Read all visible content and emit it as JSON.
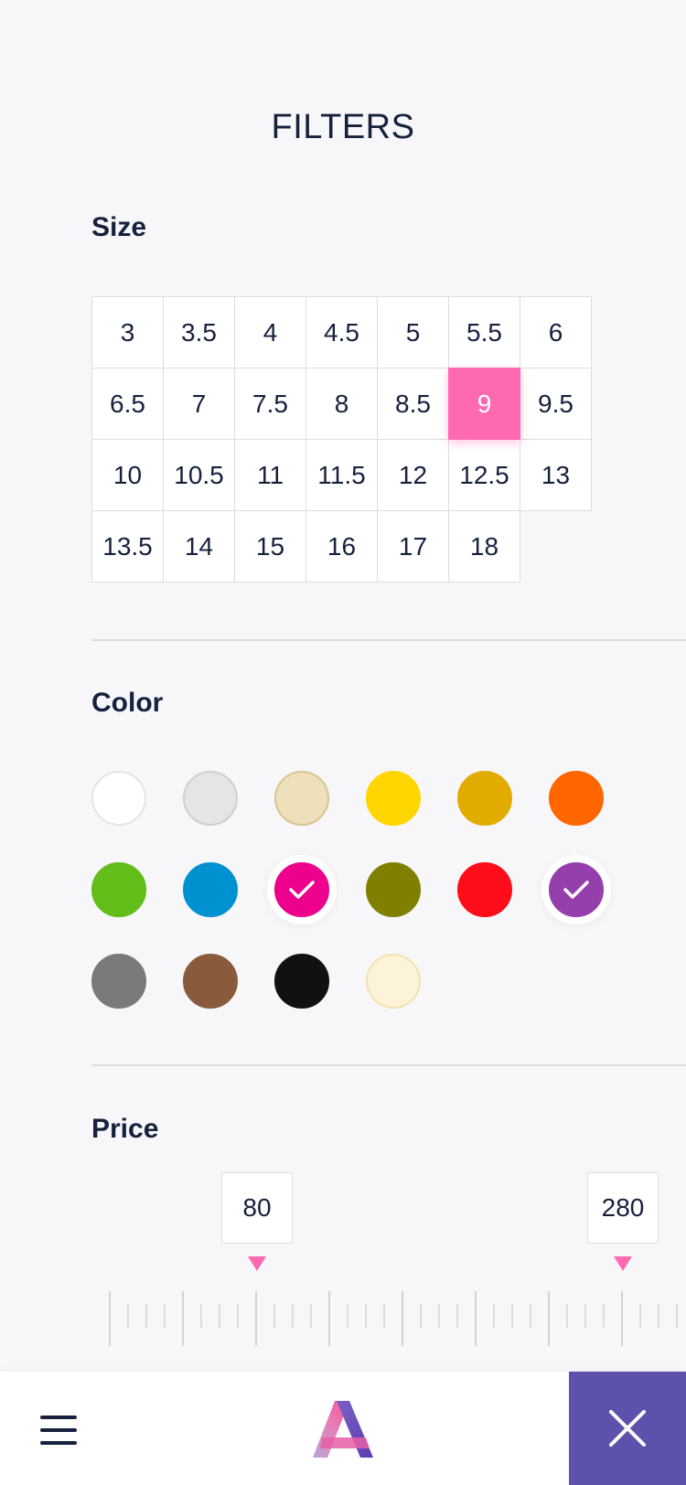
{
  "header": {
    "title": "FILTERS"
  },
  "size": {
    "label": "Size",
    "options": [
      "3",
      "3.5",
      "4",
      "4.5",
      "5",
      "5.5",
      "6",
      "6.5",
      "7",
      "7.5",
      "8",
      "8.5",
      "9",
      "9.5",
      "10",
      "10.5",
      "11",
      "11.5",
      "12",
      "12.5",
      "13",
      "13.5",
      "14",
      "15",
      "16",
      "17",
      "18"
    ],
    "selected": "9"
  },
  "color": {
    "label": "Color",
    "swatches": [
      {
        "name": "white",
        "hex": "#ffffff",
        "border": "#e4e4e8",
        "checked": false
      },
      {
        "name": "light-gray",
        "hex": "#e5e5e5",
        "border": "#cfcfcf",
        "checked": false
      },
      {
        "name": "beige",
        "hex": "#ede0bb",
        "border": "#d8c48f",
        "checked": false
      },
      {
        "name": "yellow",
        "hex": "#ffd600",
        "border": "#ffd600",
        "checked": false
      },
      {
        "name": "mustard",
        "hex": "#e2ab00",
        "border": "#e2ab00",
        "checked": false
      },
      {
        "name": "orange",
        "hex": "#ff6600",
        "border": "#ff6600",
        "checked": false
      },
      {
        "name": "green",
        "hex": "#62bd19",
        "border": "#62bd19",
        "checked": false
      },
      {
        "name": "blue",
        "hex": "#0091d0",
        "border": "#0091d0",
        "checked": false
      },
      {
        "name": "magenta",
        "hex": "#ec008c",
        "border": "#ec008c",
        "checked": true
      },
      {
        "name": "olive",
        "hex": "#808000",
        "border": "#808000",
        "checked": false
      },
      {
        "name": "red",
        "hex": "#ff0d1a",
        "border": "#ff0d1a",
        "checked": false
      },
      {
        "name": "purple",
        "hex": "#953fac",
        "border": "#953fac",
        "checked": true
      },
      {
        "name": "gray",
        "hex": "#7a7a7a",
        "border": "#7a7a7a",
        "checked": false
      },
      {
        "name": "brown",
        "hex": "#8a5a3c",
        "border": "#8a5a3c",
        "checked": false
      },
      {
        "name": "black",
        "hex": "#111111",
        "border": "#111111",
        "checked": false
      },
      {
        "name": "cream",
        "hex": "#fdf3d8",
        "border": "#f3e2b0",
        "checked": false
      }
    ]
  },
  "price": {
    "label": "Price",
    "min_value": "80",
    "max_value": "280"
  },
  "bottom_bar": {
    "menu_icon": "hamburger-menu-icon",
    "logo_icon": "brand-logo-icon",
    "close_icon": "close-icon",
    "accent_color": "#5c52ab"
  },
  "theme": {
    "highlight": "#ff69b0",
    "text": "#16213d",
    "background": "#f7f7f9"
  }
}
